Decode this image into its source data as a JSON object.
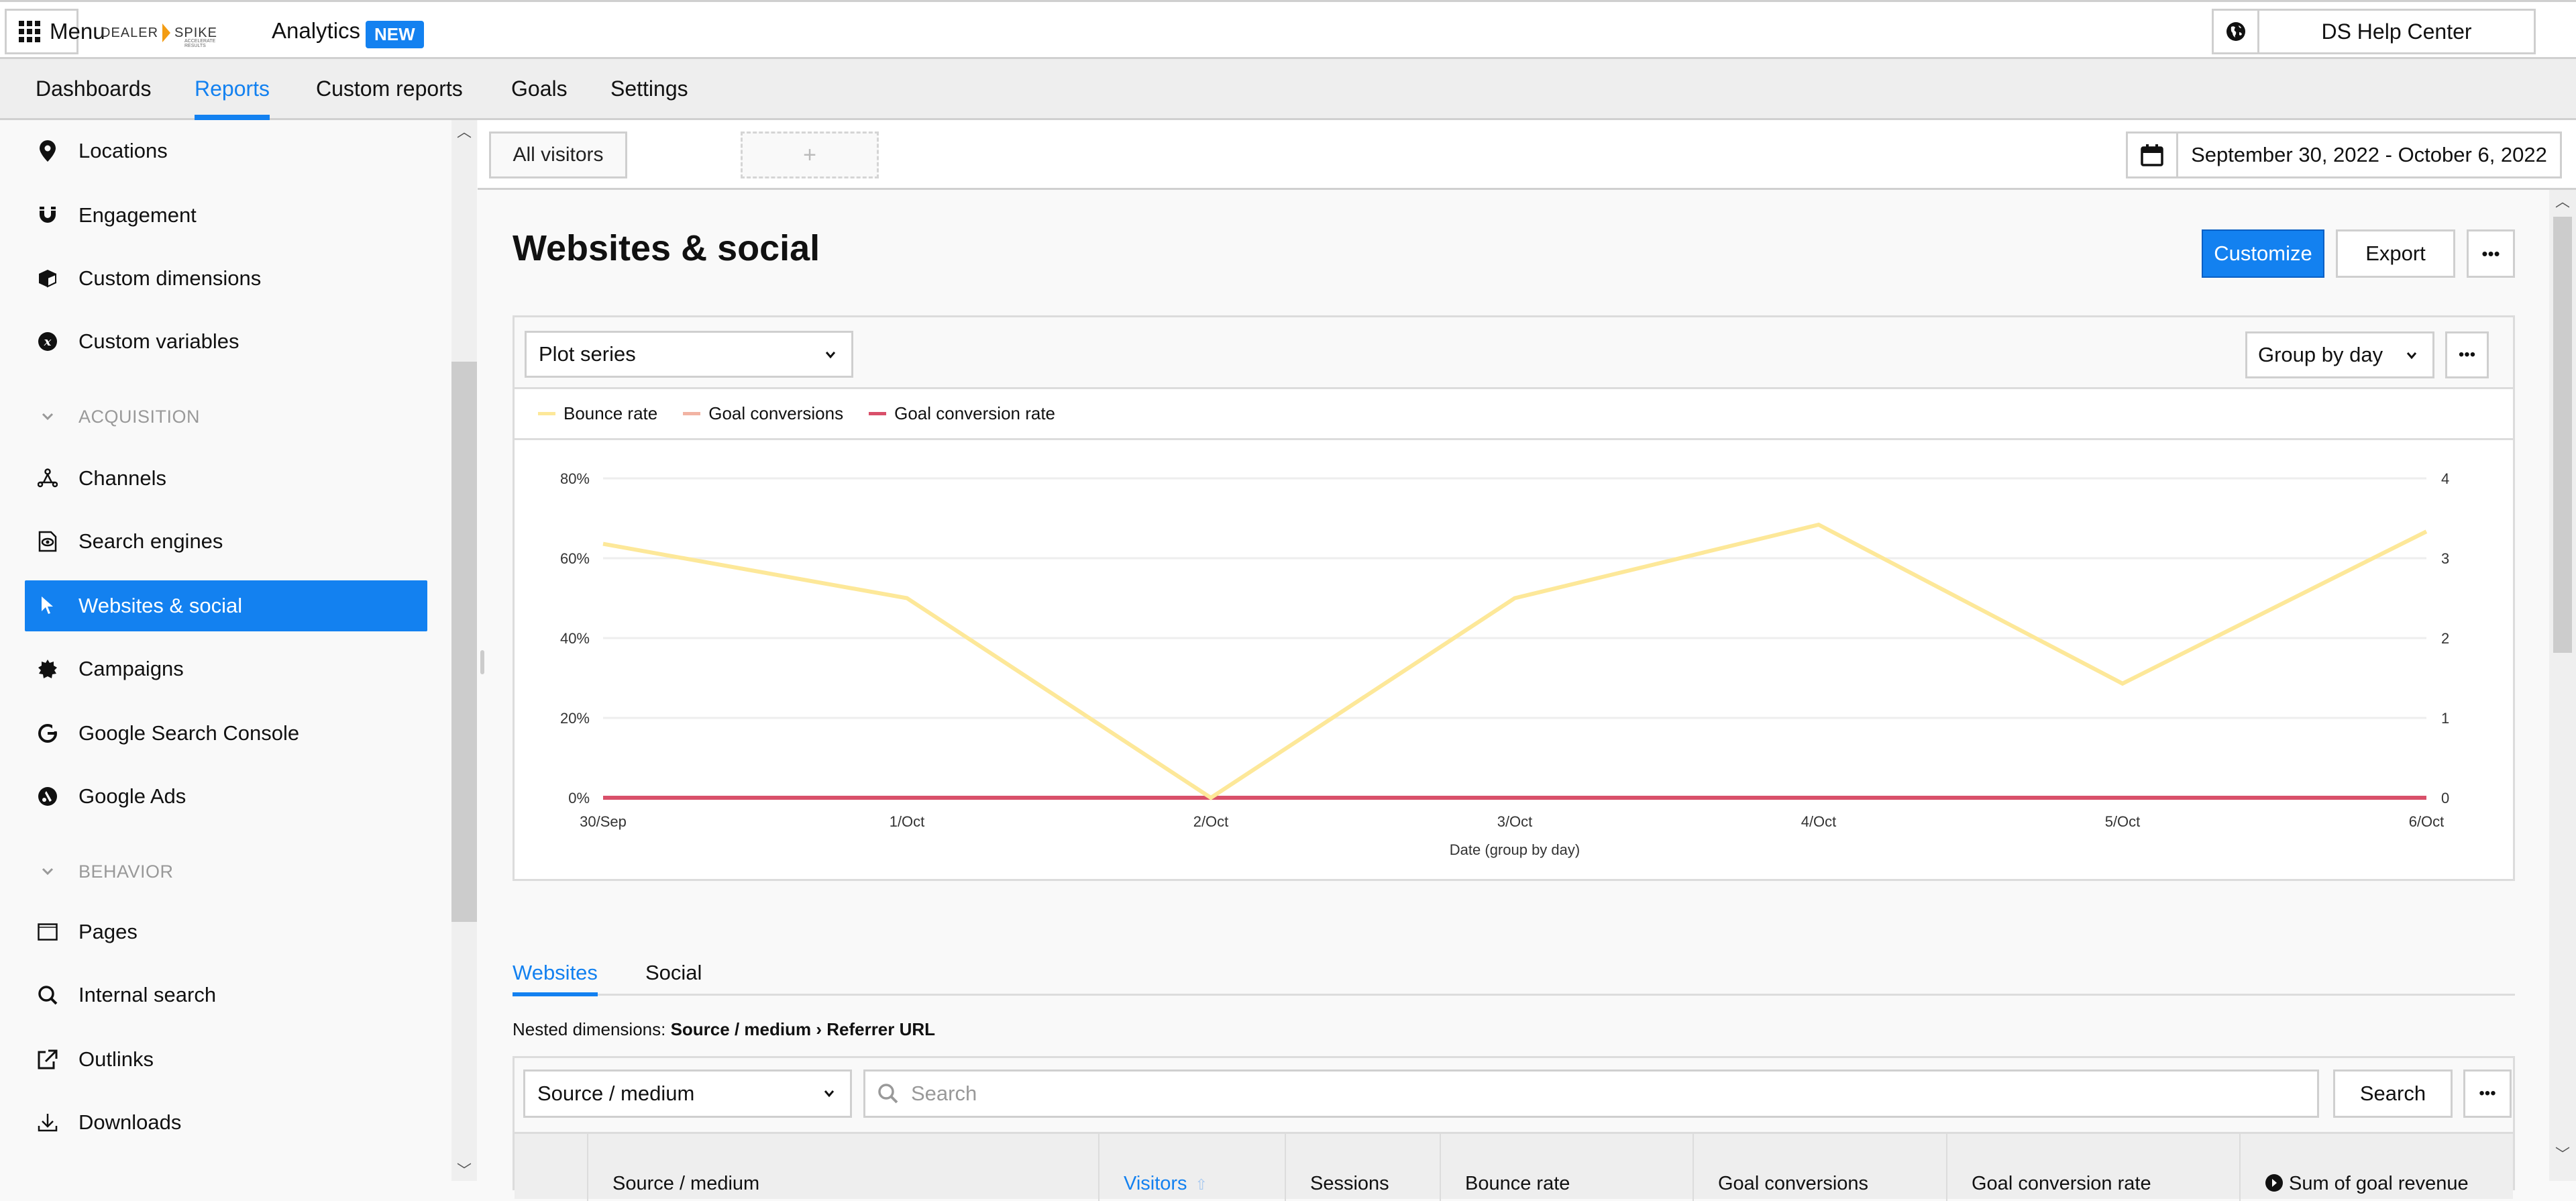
{
  "header": {
    "menu_label": "Menu",
    "brand_left": "DEALER",
    "brand_right": "SPIKE",
    "brand_tagline": "ACCELERATE RESULTS",
    "app_title": "Analytics",
    "new_badge": "NEW",
    "help_center_label": "DS Help Center"
  },
  "nav": {
    "items": [
      {
        "label": "Dashboards",
        "active": false
      },
      {
        "label": "Reports",
        "active": true
      },
      {
        "label": "Custom reports",
        "active": false
      },
      {
        "label": "Goals",
        "active": false
      },
      {
        "label": "Settings",
        "active": false
      }
    ]
  },
  "sidebar": {
    "items": [
      {
        "label": "Locations",
        "icon": "map-pin-icon"
      },
      {
        "label": "Engagement",
        "icon": "magnet-icon"
      },
      {
        "label": "Custom dimensions",
        "icon": "cube-icon"
      },
      {
        "label": "Custom variables",
        "icon": "variable-x-icon"
      }
    ],
    "acquisition_label": "ACQUISITION",
    "acquisition_items": [
      {
        "label": "Channels",
        "icon": "channels-icon"
      },
      {
        "label": "Search engines",
        "icon": "search-engine-icon"
      },
      {
        "label": "Websites & social",
        "icon": "cursor-icon",
        "active": true
      },
      {
        "label": "Campaigns",
        "icon": "badge-icon"
      },
      {
        "label": "Google Search Console",
        "icon": "google-icon"
      },
      {
        "label": "Google Ads",
        "icon": "google-ads-icon"
      }
    ],
    "behavior_label": "BEHAVIOR",
    "behavior_items": [
      {
        "label": "Pages",
        "icon": "browser-window-icon"
      },
      {
        "label": "Internal search",
        "icon": "search-icon"
      },
      {
        "label": "Outlinks",
        "icon": "external-link-icon"
      },
      {
        "label": "Downloads",
        "icon": "download-icon"
      }
    ]
  },
  "segments": {
    "current": "All visitors",
    "add_label": "+"
  },
  "date_range": "September 30, 2022 - October 6, 2022",
  "page": {
    "title": "Websites & social",
    "customize_label": "Customize",
    "export_label": "Export",
    "more_label": "•••"
  },
  "chart_controls": {
    "plot_series_label": "Plot series",
    "group_by_label": "Group by day",
    "more_label": "•••"
  },
  "colors": {
    "accent": "#1381f0",
    "bounce_rate": "#fde899",
    "goal_conversions": "#f2b3a3",
    "goal_conversion_rate": "#d9506a"
  },
  "chart_data": {
    "type": "line",
    "title": "",
    "xlabel": "Date (group by day)",
    "ylabel_left": "",
    "ylabel_right": "",
    "categories": [
      "30/Sep",
      "1/Oct",
      "2/Oct",
      "3/Oct",
      "4/Oct",
      "5/Oct",
      "6/Oct"
    ],
    "y_left": {
      "ticks": [
        "0%",
        "20%",
        "40%",
        "60%",
        "80%"
      ],
      "range": [
        0,
        80
      ],
      "unit": "%"
    },
    "y_right": {
      "ticks": [
        "0",
        "1",
        "2",
        "3",
        "4"
      ],
      "range": [
        0,
        4
      ]
    },
    "grid": true,
    "legend_position": "top-left",
    "series": [
      {
        "name": "Bounce rate",
        "axis": "left",
        "color": "#fde899",
        "values": [
          63.6,
          50,
          0,
          50,
          68.4,
          28.6,
          66.7
        ]
      },
      {
        "name": "Goal conversions",
        "axis": "right",
        "color": "#f2b3a3",
        "values": [
          0,
          0,
          0,
          0,
          0,
          0,
          0
        ]
      },
      {
        "name": "Goal conversion rate",
        "axis": "left",
        "color": "#d9506a",
        "values": [
          0,
          0,
          0,
          0,
          0,
          0,
          0
        ]
      }
    ]
  },
  "tabs": [
    {
      "label": "Websites",
      "active": true
    },
    {
      "label": "Social",
      "active": false
    }
  ],
  "nested_dimensions": {
    "prefix": "Nested dimensions:",
    "first": "Source / medium",
    "separator": "›",
    "second": "Referrer URL"
  },
  "table": {
    "dimension_select": "Source / medium",
    "search_placeholder": "Search",
    "search_value": "",
    "search_button": "Search",
    "more_label": "•••",
    "columns": [
      {
        "label": "Source / medium"
      },
      {
        "label": "Visitors",
        "sorted": true,
        "sort_icon": "⇧"
      },
      {
        "label": "Sessions"
      },
      {
        "label": "Bounce rate"
      },
      {
        "label": "Goal conversions"
      },
      {
        "label": "Goal conversion rate"
      },
      {
        "label": "Sum of goal revenue",
        "icon": "info-icon"
      }
    ]
  }
}
